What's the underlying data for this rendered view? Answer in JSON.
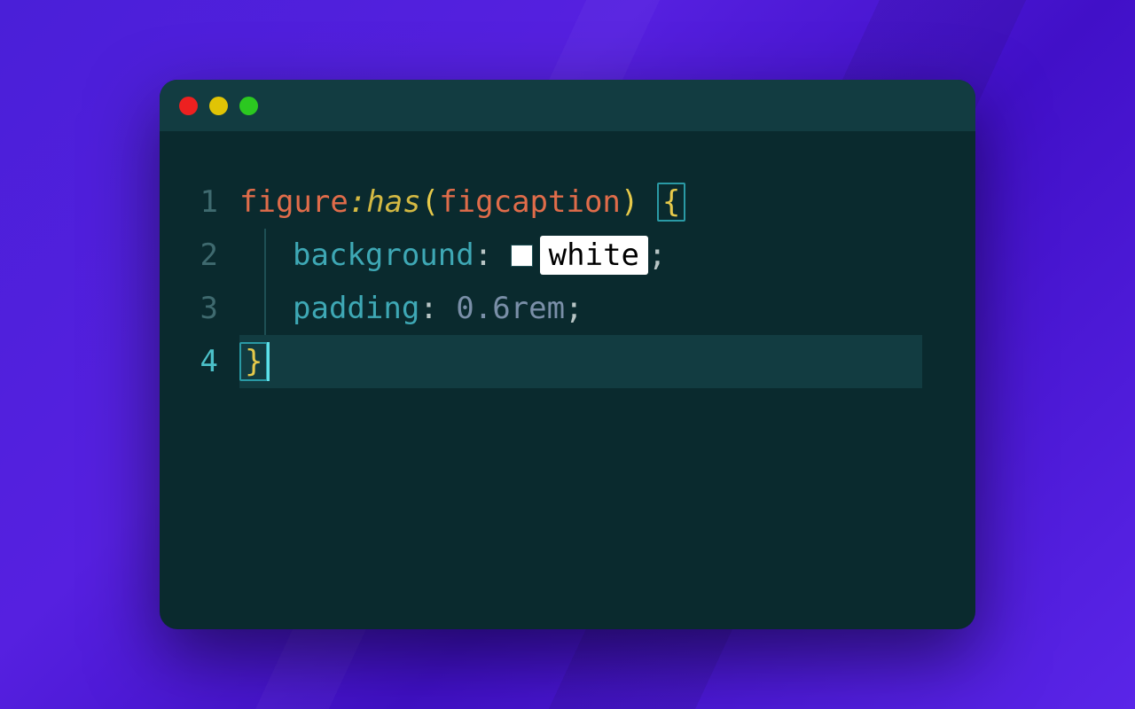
{
  "gutter": {
    "1": "1",
    "2": "2",
    "3": "3",
    "4": "4"
  },
  "code": {
    "line1": {
      "selector_tag": "figure",
      "pseudo": ":has",
      "lparen": "(",
      "arg": "figcaption",
      "rparen": ")",
      "space": " ",
      "open_brace": "{"
    },
    "line2": {
      "prop": "background",
      "colon": ": ",
      "value": "white",
      "semi": ";"
    },
    "line3": {
      "prop": "padding",
      "colon": ": ",
      "value": "0.6rem",
      "semi": ";"
    },
    "line4": {
      "close_brace": "}"
    }
  }
}
